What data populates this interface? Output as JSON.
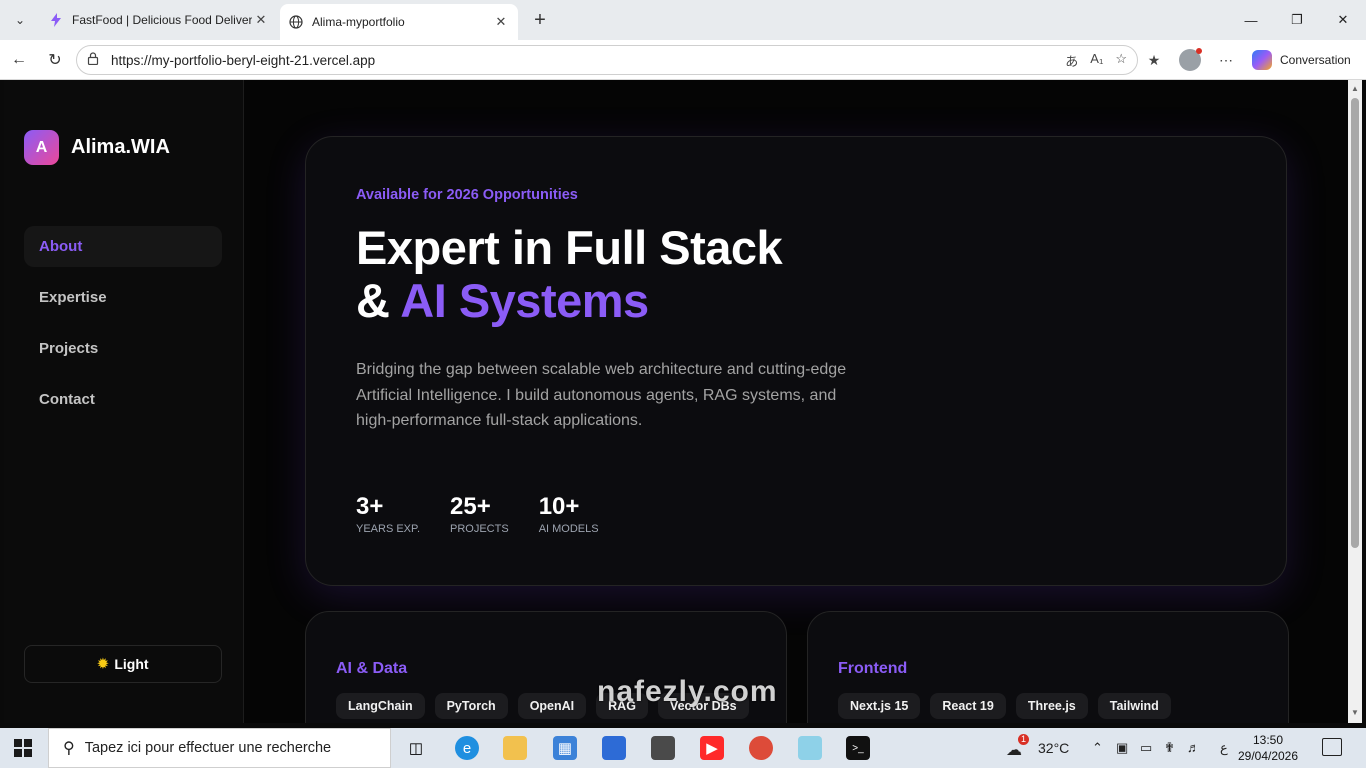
{
  "browser": {
    "tabs": [
      {
        "title": "FastFood | Delicious Food Delivery",
        "favicon": "bolt-icon",
        "active": false
      },
      {
        "title": "Alima-myportfolio",
        "favicon": "globe-icon",
        "active": true
      }
    ],
    "url": "https://my-portfolio-beryl-eight-21.vercel.app",
    "copilot_label": "Conversation"
  },
  "sidebar": {
    "brand_mark": "A",
    "brand_name": "Alima.WIA",
    "nav": [
      "About",
      "Expertise",
      "Projects",
      "Contact"
    ],
    "active_index": 0,
    "theme_toggle": "Light"
  },
  "hero": {
    "badge": "Available for 2026 Opportunities",
    "headline_line1": "Expert in Full Stack",
    "headline_prefix": "& ",
    "headline_accent": "AI Systems",
    "description": "Bridging the gap between scalable web architecture and cutting-edge Artificial Intelligence. I build autonomous agents, RAG systems, and high-performance full-stack applications.",
    "stats": [
      {
        "value": "3+",
        "label": "YEARS EXP."
      },
      {
        "value": "25+",
        "label": "PROJECTS"
      },
      {
        "value": "10+",
        "label": "AI MODELS"
      }
    ]
  },
  "cards": [
    {
      "title": "AI & Data",
      "chips": [
        "LangChain",
        "PyTorch",
        "OpenAI",
        "RAG",
        "Vector DBs"
      ]
    },
    {
      "title": "Frontend",
      "chips": [
        "Next.js 15",
        "React 19",
        "Three.js",
        "Tailwind"
      ]
    }
  ],
  "watermark": "nafezly.com",
  "taskbar": {
    "search_placeholder": "Tapez ici pour effectuer une recherche",
    "weather": "32°C",
    "lang": "ع",
    "time": "13:50",
    "date": "29/04/2026",
    "weather_badge": "1"
  },
  "colors": {
    "accent": "#8b5cf6",
    "page_bg": "#050505",
    "card_bg": "#0c0c0f"
  }
}
